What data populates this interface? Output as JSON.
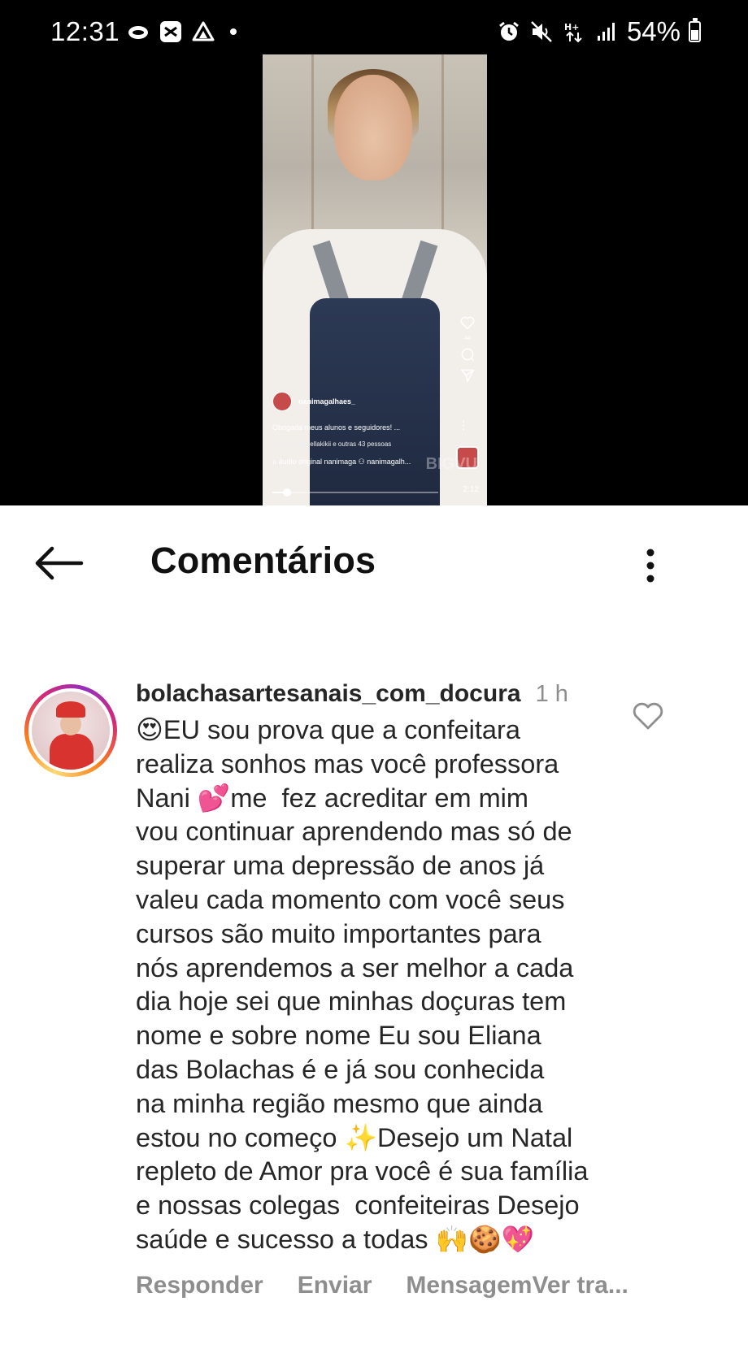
{
  "status_bar": {
    "time": "12:31",
    "left_icons": [
      "cloud-icon",
      "capcut-icon",
      "drive-icon",
      "notification-dot"
    ],
    "right_icons": [
      "alarm-icon",
      "mute-icon",
      "data-transfer-icon",
      "signal-icon"
    ],
    "battery_percent": "54%",
    "battery_level": 0.54
  },
  "video": {
    "username": "nanimagalhaes_",
    "caption": "Obrigada meus alunos e seguidores! ...",
    "liked_by": "Curtido por bellakikii e outras 43 pessoas",
    "audio": "áudio original   nanimaga",
    "tagged": "nanimagalh...",
    "like_count": "44",
    "watermark": "BIGVU",
    "duration": "2:12",
    "progress": 0.09
  },
  "header": {
    "title": "Comentários"
  },
  "comment": {
    "username": "bolachasartesanais_com_docura",
    "time": "1 h",
    "text": "😍EU sou prova que a confeitara\nrealiza sonhos mas você professora\nNani 💕me  fez acreditar em mim\nvou continuar aprendendo mas só de\nsuperar uma depressão de anos já\nvaleu cada momento com você seus\ncursos são muito importantes para\nnós aprendemos a ser melhor a cada\ndia hoje sei que minhas doçuras tem\nnome e sobre nome Eu sou Eliana\ndas Bolachas é e já sou conhecida\nna minha região mesmo que ainda\nestou no começo ✨Desejo um Natal\nrepleto de Amor pra você é sua família\ne nossas colegas  confeiteiras Desejo\nsaúde e sucesso a todas 🙌🍪💖",
    "actions": {
      "reply": "Responder",
      "send": "Enviar",
      "message": "Mensagem",
      "translate": "Ver tra..."
    }
  },
  "colors": {
    "top_background": "#000000",
    "text_primary": "#262626",
    "text_secondary": "#8e8e8e",
    "story_ring_start": "#feda75",
    "story_ring_end": "#962fbf"
  }
}
